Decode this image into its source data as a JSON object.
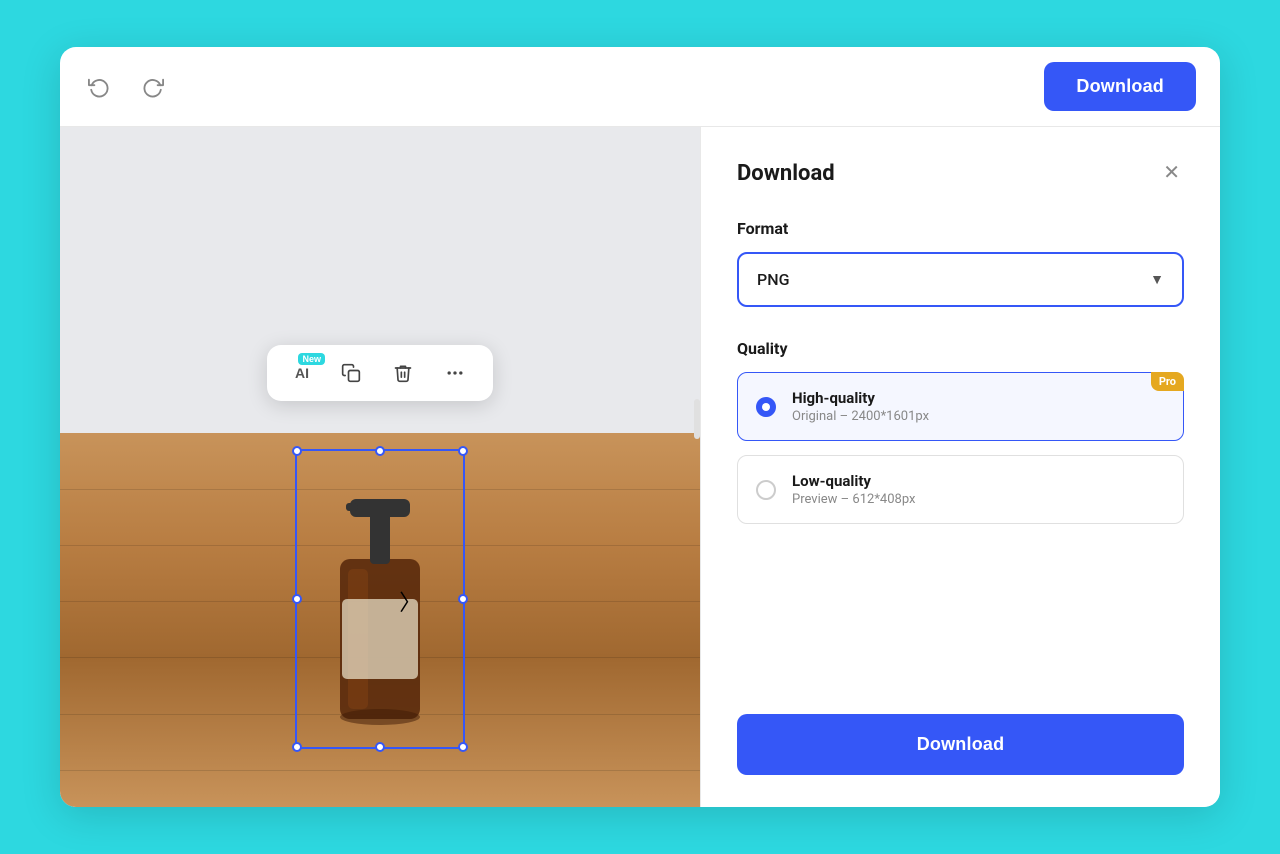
{
  "toolbar": {
    "undo_title": "Undo",
    "redo_title": "Redo",
    "download_label": "Download"
  },
  "floating_toolbar": {
    "ai_label": "AI",
    "new_badge": "New",
    "copy_title": "Copy",
    "delete_title": "Delete",
    "more_title": "More options"
  },
  "download_panel": {
    "title": "Download",
    "format_label": "Format",
    "format_value": "PNG",
    "quality_label": "Quality",
    "quality_options": [
      {
        "id": "high",
        "name": "High-quality",
        "detail": "Original – 2400*1601px",
        "pro": true,
        "selected": true
      },
      {
        "id": "low",
        "name": "Low-quality",
        "detail": "Preview – 612*408px",
        "pro": false,
        "selected": false
      }
    ],
    "pro_badge": "Pro",
    "download_btn": "Download",
    "close_title": "Close"
  }
}
